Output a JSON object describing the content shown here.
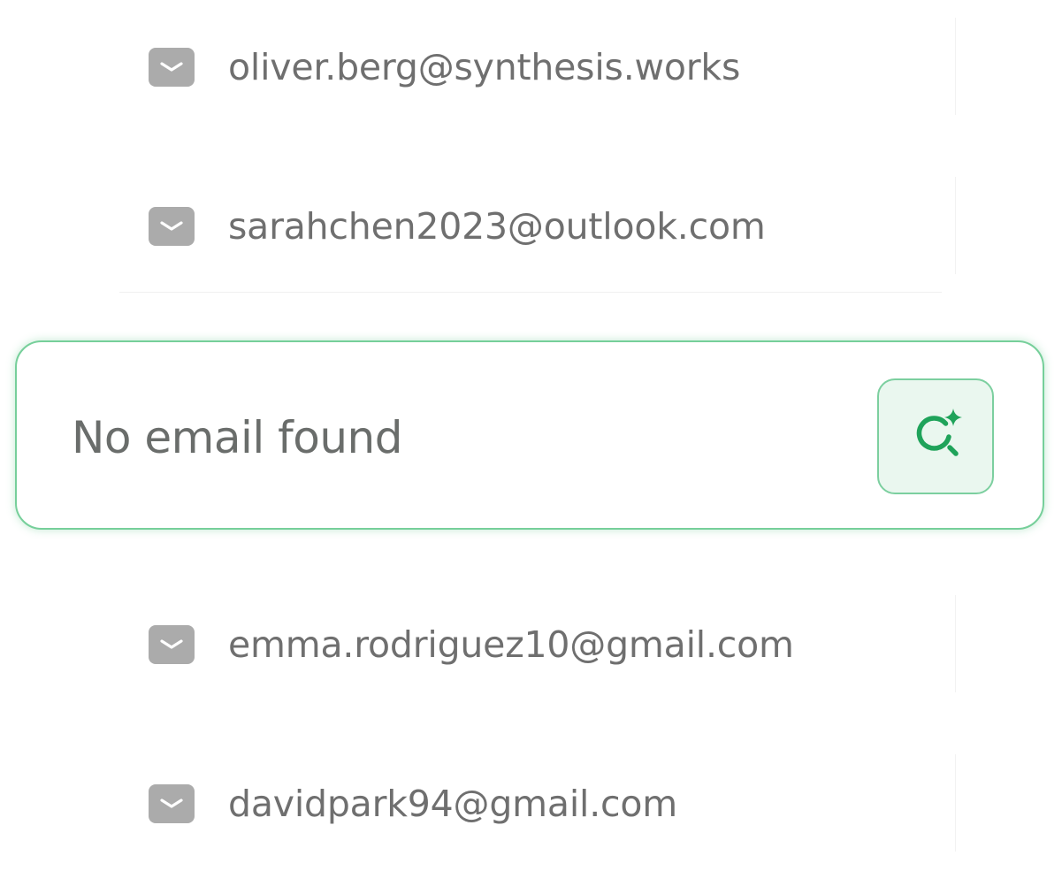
{
  "emails": [
    {
      "address": "oliver.berg@synthesis.works",
      "icon": "mail-icon"
    },
    {
      "address": "sarahchen2023@outlook.com",
      "icon": "mail-icon"
    },
    {
      "address": "emma.rodriguez10@gmail.com",
      "icon": "mail-icon"
    },
    {
      "address": "davidpark94@gmail.com",
      "icon": "mail-icon"
    }
  ],
  "highlight": {
    "message": "No email found",
    "action_icon": "ai-search-icon",
    "accent_color": "#1fa35a",
    "border_color": "#76cf9a"
  }
}
